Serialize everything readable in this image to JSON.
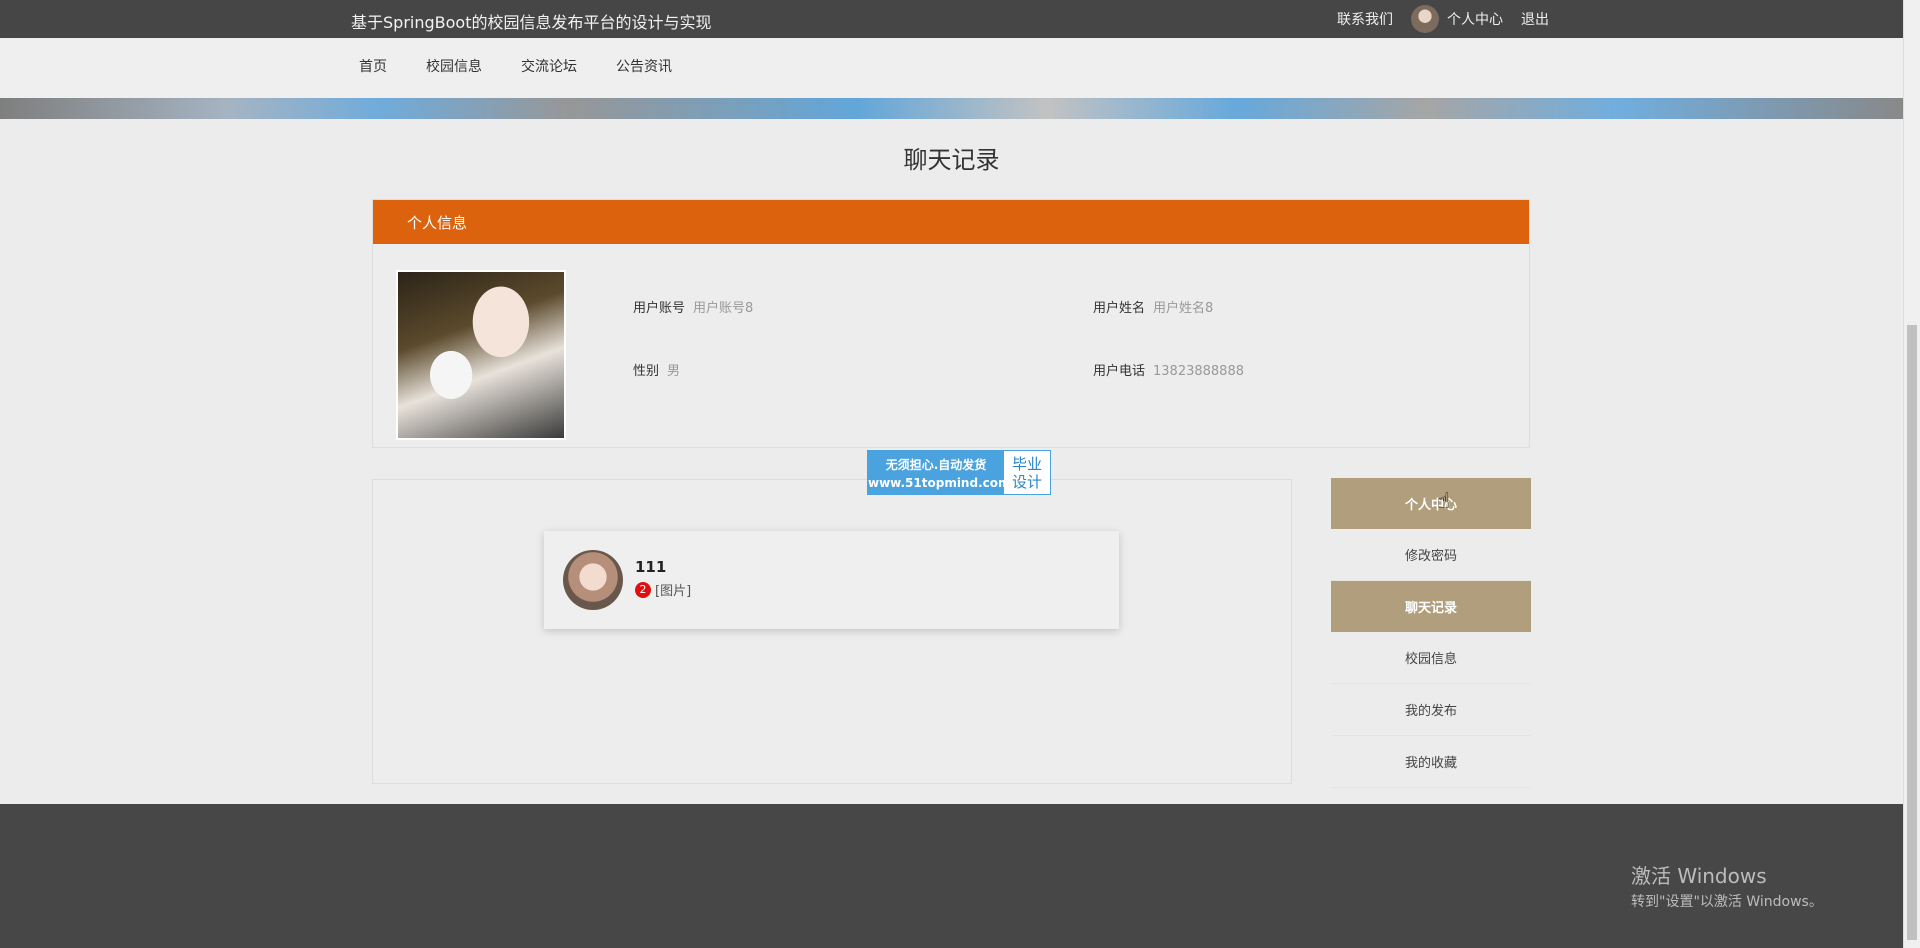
{
  "header": {
    "site_title": "基于SpringBoot的校园信息发布平台的设计与实现",
    "contact": "联系我们",
    "user_center": "个人中心",
    "logout": "退出"
  },
  "nav": {
    "items": [
      "首页",
      "校园信息",
      "交流论坛",
      "公告资讯"
    ]
  },
  "page": {
    "heading": "聊天记录"
  },
  "profile": {
    "section_title": "个人信息",
    "fields": {
      "account_label": "用户账号",
      "account_value": "用户账号8",
      "name_label": "用户姓名",
      "name_value": "用户姓名8",
      "gender_label": "性别",
      "gender_value": "男",
      "phone_label": "用户电话",
      "phone_value": "13823888888"
    }
  },
  "chat": {
    "items": [
      {
        "name": "111",
        "unread": "2",
        "preview": "[图片]"
      }
    ]
  },
  "ad": {
    "line1": "无须担心.自动发货",
    "line2": "www.51topmind.com",
    "right1": "毕业",
    "right2": "设计"
  },
  "sidebar": {
    "items": [
      {
        "label": "个人中心",
        "active": true
      },
      {
        "label": "修改密码",
        "active": false
      },
      {
        "label": "聊天记录",
        "active": true
      },
      {
        "label": "校园信息",
        "active": false
      },
      {
        "label": "我的发布",
        "active": false
      },
      {
        "label": "我的收藏",
        "active": false
      }
    ]
  },
  "windows_overlay": {
    "title": "激活 Windows",
    "subtitle": "转到\"设置\"以激活 Windows。"
  },
  "colors": {
    "accent_orange": "#dd620e",
    "sidebar_active": "#b09e7c",
    "topbar": "#464646"
  }
}
